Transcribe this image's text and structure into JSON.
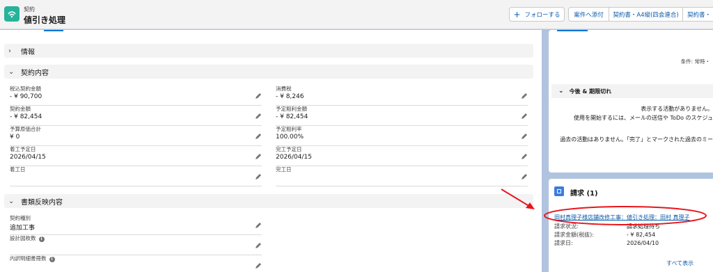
{
  "header": {
    "object_type": "契約",
    "record_name": "値引き処理",
    "buttons": {
      "follow": "フォローする",
      "attach": "案件へ添付",
      "contract_a4": "契約書・A4縦(四会連合)",
      "contract_more": "契約書・"
    }
  },
  "sections": {
    "info": "情報",
    "contract": "契約内容",
    "docs": "書類反映内容"
  },
  "contract_fields": {
    "tax_incl_amount": {
      "label": "税込契約金額",
      "value": "- ¥ 90,700"
    },
    "consumption_tax": {
      "label": "消費税",
      "value": "- ¥ 8,246"
    },
    "contract_amount": {
      "label": "契約金額",
      "value": "- ¥ 82,454"
    },
    "planned_gross_profit": {
      "label": "予定粗利金額",
      "value": "- ¥ 82,454"
    },
    "budget_cost_total": {
      "label": "予算原価合計",
      "value": "¥ 0"
    },
    "planned_gross_margin": {
      "label": "予定粗利率",
      "value": "100.00%"
    },
    "planned_start": {
      "label": "着工予定日",
      "value": "2026/04/15"
    },
    "planned_complete": {
      "label": "完工予定日",
      "value": "2026/04/15"
    },
    "start_date": {
      "label": "着工日",
      "value": ""
    },
    "complete_date": {
      "label": "完工日",
      "value": ""
    }
  },
  "doc_fields": {
    "contract_type": {
      "label": "契約種別",
      "value": "追加工事"
    },
    "drawing_count": {
      "label": "設計図枚数",
      "value": ""
    },
    "breakdown_count": {
      "label": "内訳明細書冊数",
      "value": ""
    }
  },
  "activity": {
    "condition": "条件: 常時・",
    "upcoming_header": "今後 & 期限切れ",
    "no_activity": "表示する活動がありません。",
    "start_hint": "使用を開始するには、メールの送信や ToDo のスケジュ",
    "past_none": "過去の活動はありません。「完了」とマークされた過去のミー"
  },
  "billing": {
    "title": "請求 (1)",
    "link": "田村真理子様店舗改修工事：値引き処理：田村 真理子",
    "rows": [
      {
        "key": "請求状況:",
        "value": "請求処理待ち"
      },
      {
        "key": "請求金額(税抜):",
        "value": "- ¥ 82,454"
      },
      {
        "key": "請求日:",
        "value": "2026/04/10"
      }
    ],
    "view_all": "すべて表示"
  },
  "colors": {
    "brand_icon": "#26b39a",
    "link": "#0b5cab",
    "annotation": "#e8141b",
    "page_bg": "#b0c4df"
  }
}
